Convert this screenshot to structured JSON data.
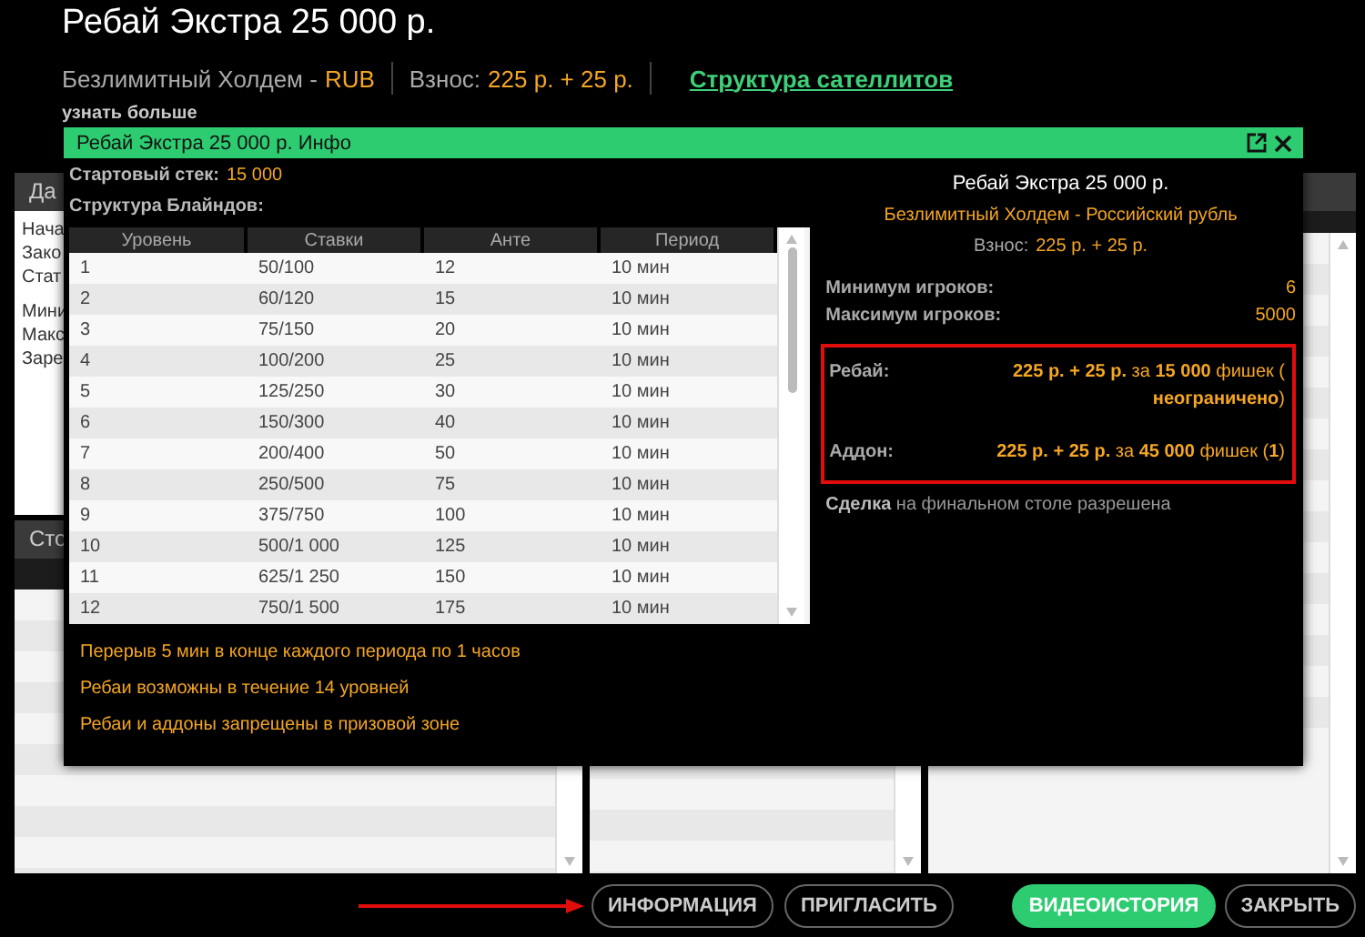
{
  "header": {
    "title": "Ребай Экстра 25 000 р.",
    "game": "Безлимитный Холдем -",
    "currency": "RUB",
    "buyin_label": "Взнос:",
    "buyin_value": "225 р. + 25 р.",
    "satellite_link": "Структура сателлитов",
    "learn_more": "узнать больше"
  },
  "background": {
    "left_tab": "Да",
    "left_lines": [
      "Нача",
      "Зако",
      "Стат",
      "Мини",
      "Макс",
      "Заре"
    ],
    "lower_tab": "Сто"
  },
  "modal": {
    "title": "Ребай Экстра 25 000 р. Инфо",
    "stack_label": "Стартовый стек:",
    "stack_value": "15 000",
    "blinds_label": "Структура Блайндов:",
    "columns": [
      "Уровень",
      "Ставки",
      "Анте",
      "Период"
    ],
    "rows": [
      [
        "1",
        "50/100",
        "12",
        "10 мин"
      ],
      [
        "2",
        "60/120",
        "15",
        "10 мин"
      ],
      [
        "3",
        "75/150",
        "20",
        "10 мин"
      ],
      [
        "4",
        "100/200",
        "25",
        "10 мин"
      ],
      [
        "5",
        "125/250",
        "30",
        "10 мин"
      ],
      [
        "6",
        "150/300",
        "40",
        "10 мин"
      ],
      [
        "7",
        "200/400",
        "50",
        "10 мин"
      ],
      [
        "8",
        "250/500",
        "75",
        "10 мин"
      ],
      [
        "9",
        "375/750",
        "100",
        "10 мин"
      ],
      [
        "10",
        "500/1 000",
        "125",
        "10 мин"
      ],
      [
        "11",
        "625/1 250",
        "150",
        "10 мин"
      ],
      [
        "12",
        "750/1 500",
        "175",
        "10 мин"
      ]
    ],
    "notes": [
      "Перерыв 5 мин в конце каждого периода по 1 часов",
      "Ребаи возможны в течение 14 уровней",
      "Ребаи и аддоны запрещены в призовой зоне"
    ],
    "info": {
      "title": "Ребай Экстра 25 000 р.",
      "game": "Безлимитный Холдем - Российский рубль",
      "buyin_label": "Взнос:",
      "buyin_value": "225 р. + 25 р.",
      "stats": [
        {
          "label": "Минимум игроков:",
          "value": "6"
        },
        {
          "label": "Максимум игроков:",
          "value": "5000"
        }
      ],
      "highlighted": [
        {
          "label": "Ребай:",
          "value": "**225 р. + 25 р.** за **15 000** фишек ( **неограничено**)"
        },
        {
          "label": "Аддон:",
          "value": "**225 р. + 25 р.** за **45 000** фишек (**1**)"
        }
      ],
      "deal": "**Сделка** на финальном столе разрешена"
    }
  },
  "footer": {
    "center_buttons": [
      {
        "label": "ИНФОРМАЦИЯ",
        "kind": "outline"
      },
      {
        "label": "ПРИГЛАСИТЬ",
        "kind": "outline"
      }
    ],
    "right_buttons": [
      {
        "label": "ВИДЕОИСТОРИЯ",
        "kind": "primary"
      },
      {
        "label": "ЗАКРЫТЬ",
        "kind": "outline"
      }
    ]
  }
}
